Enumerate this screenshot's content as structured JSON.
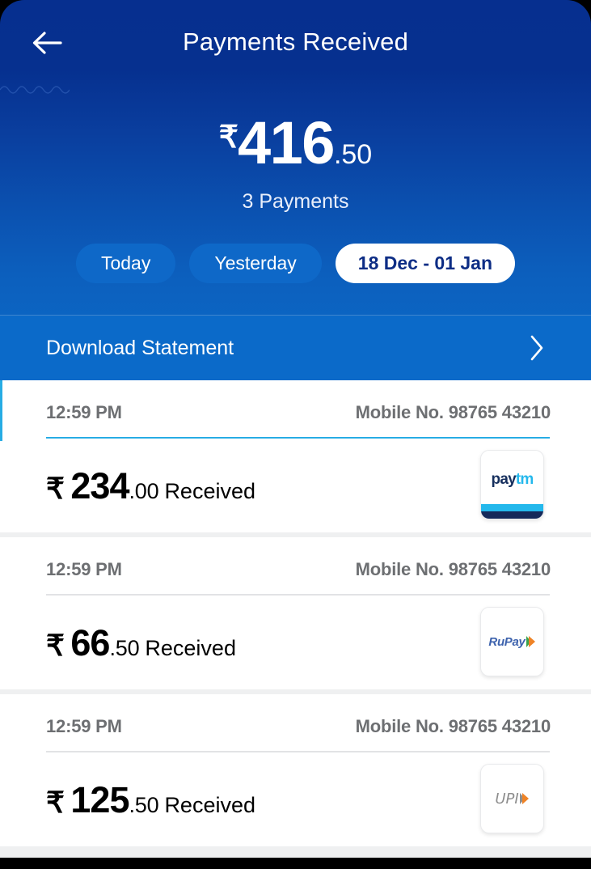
{
  "header": {
    "title": "Payments Received",
    "back_icon": "arrow-left-icon"
  },
  "summary": {
    "currency_symbol": "₹",
    "amount_major": "416",
    "amount_decimal": ".50",
    "payments_count_label": "3 Payments"
  },
  "filters": {
    "chips": [
      {
        "label": "Today",
        "selected": false
      },
      {
        "label": "Yesterday",
        "selected": false
      },
      {
        "label": "18 Dec - 01 Jan",
        "selected": true
      }
    ]
  },
  "download": {
    "label": "Download Statement",
    "chevron_icon": "chevron-right-icon"
  },
  "transactions": [
    {
      "time": "12:59 PM",
      "mobile": "Mobile No. 98765 43210",
      "currency_symbol": "₹",
      "amount_major": "234",
      "amount_decimal": ".00",
      "status": "Received",
      "brand": "paytm",
      "brand_pay": "pay",
      "brand_tm": "tm"
    },
    {
      "time": "12:59 PM",
      "mobile": "Mobile No. 98765 43210",
      "currency_symbol": "₹",
      "amount_major": "66",
      "amount_decimal": ".50",
      "status": "Received",
      "brand": "rupay",
      "brand_label": "RuPay"
    },
    {
      "time": "12:59 PM",
      "mobile": "Mobile No. 98765 43210",
      "currency_symbol": "₹",
      "amount_major": "125",
      "amount_decimal": ".50",
      "status": "Received",
      "brand": "upi",
      "brand_label": "UPI"
    }
  ],
  "colors": {
    "brand_dark_blue": "#062f8f",
    "brand_blue": "#0a68c6",
    "download_band": "#0b6ac9",
    "accent_cyan": "#27ace4",
    "chip_inactive": "#0e68c8",
    "chip_active_text": "#0d2d85",
    "muted_text": "#6d6f72"
  }
}
